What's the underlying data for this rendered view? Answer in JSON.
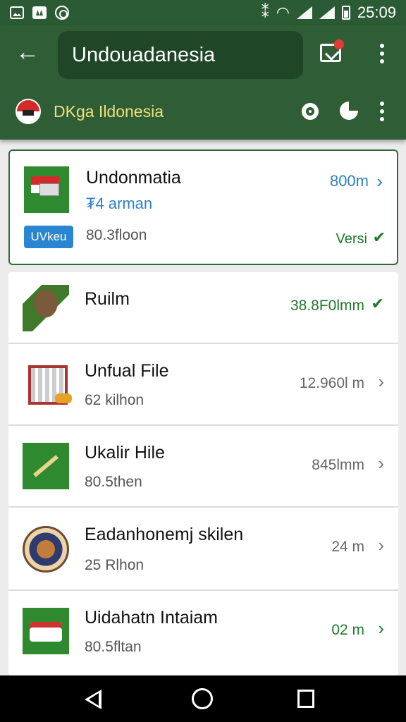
{
  "status_bar": {
    "time": "25:09",
    "signal_text": "⁸",
    "icons": [
      "photo-icon",
      "image-icon",
      "circle-icon",
      "vibrate-icon",
      "wifi-icon",
      "signal-icon",
      "battery-icon"
    ]
  },
  "app_bar": {
    "search_value": "Undouadanesia",
    "subtitle": "DKga Ildonesia",
    "colors": {
      "bar": "#2e5d36",
      "search_bg": "#1f4627",
      "subtitle": "#f1e07a"
    }
  },
  "featured": {
    "title": "Undonmatia",
    "subtitle": "₮4 arman",
    "size": "800m",
    "tag": "UVkeu",
    "count": "80.3floon",
    "status": "Versi",
    "accent": "#2d80c8",
    "status_color": "#1f7a2c"
  },
  "list": [
    {
      "title": "Ruilm",
      "count": "",
      "size": "38.8F0lmm",
      "size_color": "#1f7a2c",
      "trailing": "✔"
    },
    {
      "title": "Unfual File",
      "count": "62 kilhon",
      "size": "12.960l m",
      "size_color": "#666666",
      "trailing": "›"
    },
    {
      "title": "Ukalir Hile",
      "count": "80.5then",
      "size": "845lmm",
      "size_color": "#666666",
      "trailing": "›"
    },
    {
      "title": "Eadanhonemj skilen",
      "count": "25 Rlhon",
      "size": "24 m",
      "size_color": "#666666",
      "trailing": "›"
    },
    {
      "title": "Uidahatn Intaiam",
      "count": "80.5fltan",
      "size": "02 m",
      "size_color": "#1f7a2c",
      "trailing": "›"
    }
  ]
}
